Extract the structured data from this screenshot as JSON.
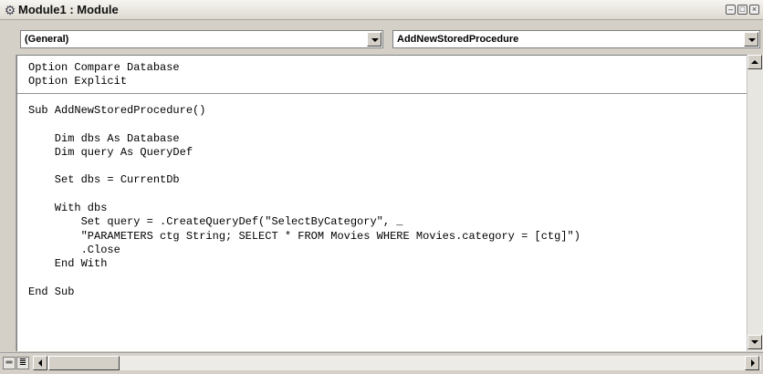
{
  "window": {
    "title": "Module1 : Module",
    "icon": "module-icon",
    "controls": [
      "minimize-icon",
      "restore-icon",
      "close-icon"
    ]
  },
  "object_combo": {
    "selected": "(General)"
  },
  "procedure_combo": {
    "selected": "AddNewStoredProcedure"
  },
  "code": {
    "declarations": "Option Compare Database\nOption Explicit",
    "body": "Sub AddNewStoredProcedure()\n\n    Dim dbs As Database\n    Dim query As QueryDef\n\n    Set dbs = CurrentDb\n\n    With dbs\n        Set query = .CreateQueryDef(\"SelectByCategory\", _\n        \"PARAMETERS ctg String; SELECT * FROM Movies WHERE Movies.category = [ctg]\")\n        .Close\n    End With\n\nEnd Sub"
  },
  "colors": {
    "background": "#f2c4b4",
    "window": "#d4d0c8",
    "editor": "#ffffff"
  }
}
